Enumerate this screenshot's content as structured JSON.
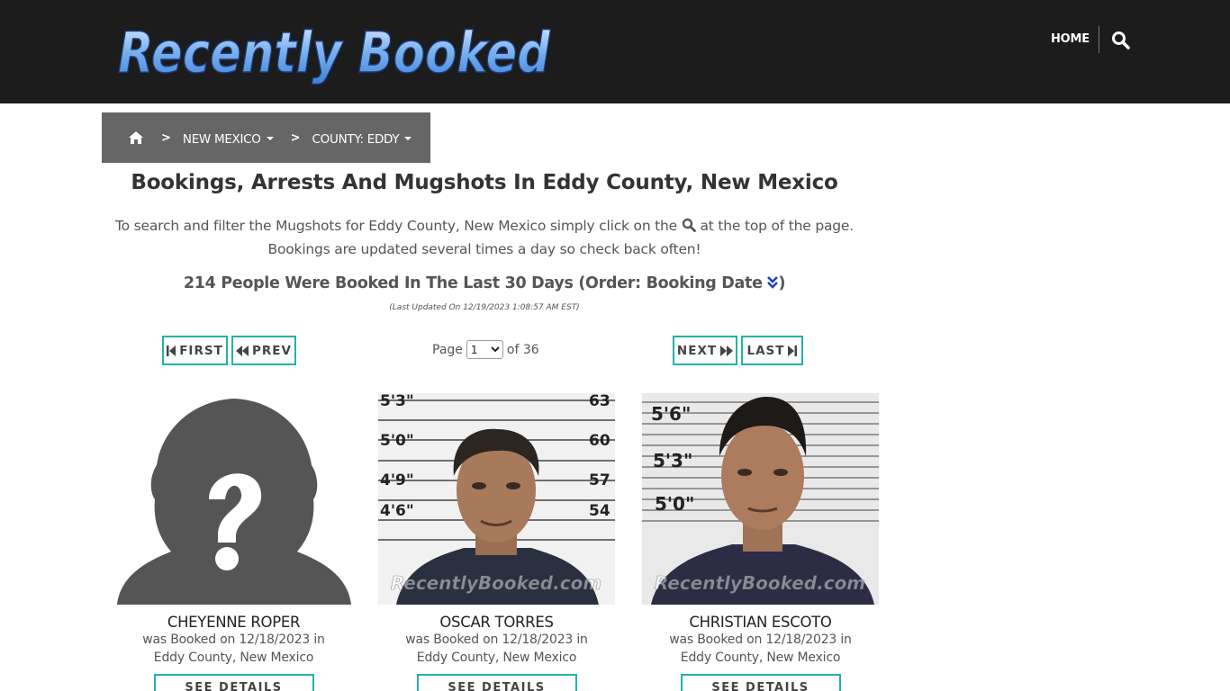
{
  "header": {
    "logo_text": "Recently Booked",
    "nav_home": "HOME",
    "search_icon": "search-icon"
  },
  "breadcrumb": {
    "home_icon": "home-icon",
    "separator": ">",
    "state": "NEW MEXICO",
    "county": "COUNTY: EDDY"
  },
  "main": {
    "title": "Bookings, Arrests And Mugshots In Eddy County, New Mexico",
    "intro_before": "To search and filter the Mugshots for Eddy County, New Mexico simply click on the",
    "intro_after": "at the top of the page.",
    "intro_line2": "Bookings are updated several times a day so check back often!",
    "count_text": "214 People Were Booked In The Last 30 Days (Order: Booking Date",
    "count_close": ")",
    "updated": "(Last Updated On 12/19/2023 1:08:57 AM EST)"
  },
  "pagination": {
    "first": "FIRST",
    "prev": "PREV",
    "next": "NEXT",
    "last": "LAST",
    "page_label": "Page",
    "current_page": "1",
    "of_label": "of 36"
  },
  "colors": {
    "accent": "#21b3a8",
    "header_bg": "#1c1c1c",
    "breadcrumb_bg": "#666666"
  },
  "bookings": [
    {
      "name": "CHEYENNE ROPER",
      "line1": "was Booked on 12/18/2023 in",
      "line2": "Eddy County, New Mexico",
      "button": "SEE DETAILS",
      "photo": "placeholder-silhouette"
    },
    {
      "name": "OSCAR TORRES",
      "line1": "was Booked on 12/18/2023 in",
      "line2": "Eddy County, New Mexico",
      "button": "SEE DETAILS",
      "photo": "mugshot",
      "height_marks": [
        "5'3\"",
        "5'0\"",
        "4'9\"",
        "4'6\""
      ],
      "right_marks": [
        "63",
        "60",
        "57",
        "54"
      ],
      "watermark": "RecentlyBooked.com"
    },
    {
      "name": "CHRISTIAN ESCOTO",
      "line1": "was Booked on 12/18/2023 in",
      "line2": "Eddy County, New Mexico",
      "button": "SEE DETAILS",
      "photo": "mugshot",
      "height_marks": [
        "5'6\"",
        "5'3\"",
        "5'0\""
      ],
      "watermark": "RecentlyBooked.com"
    }
  ]
}
